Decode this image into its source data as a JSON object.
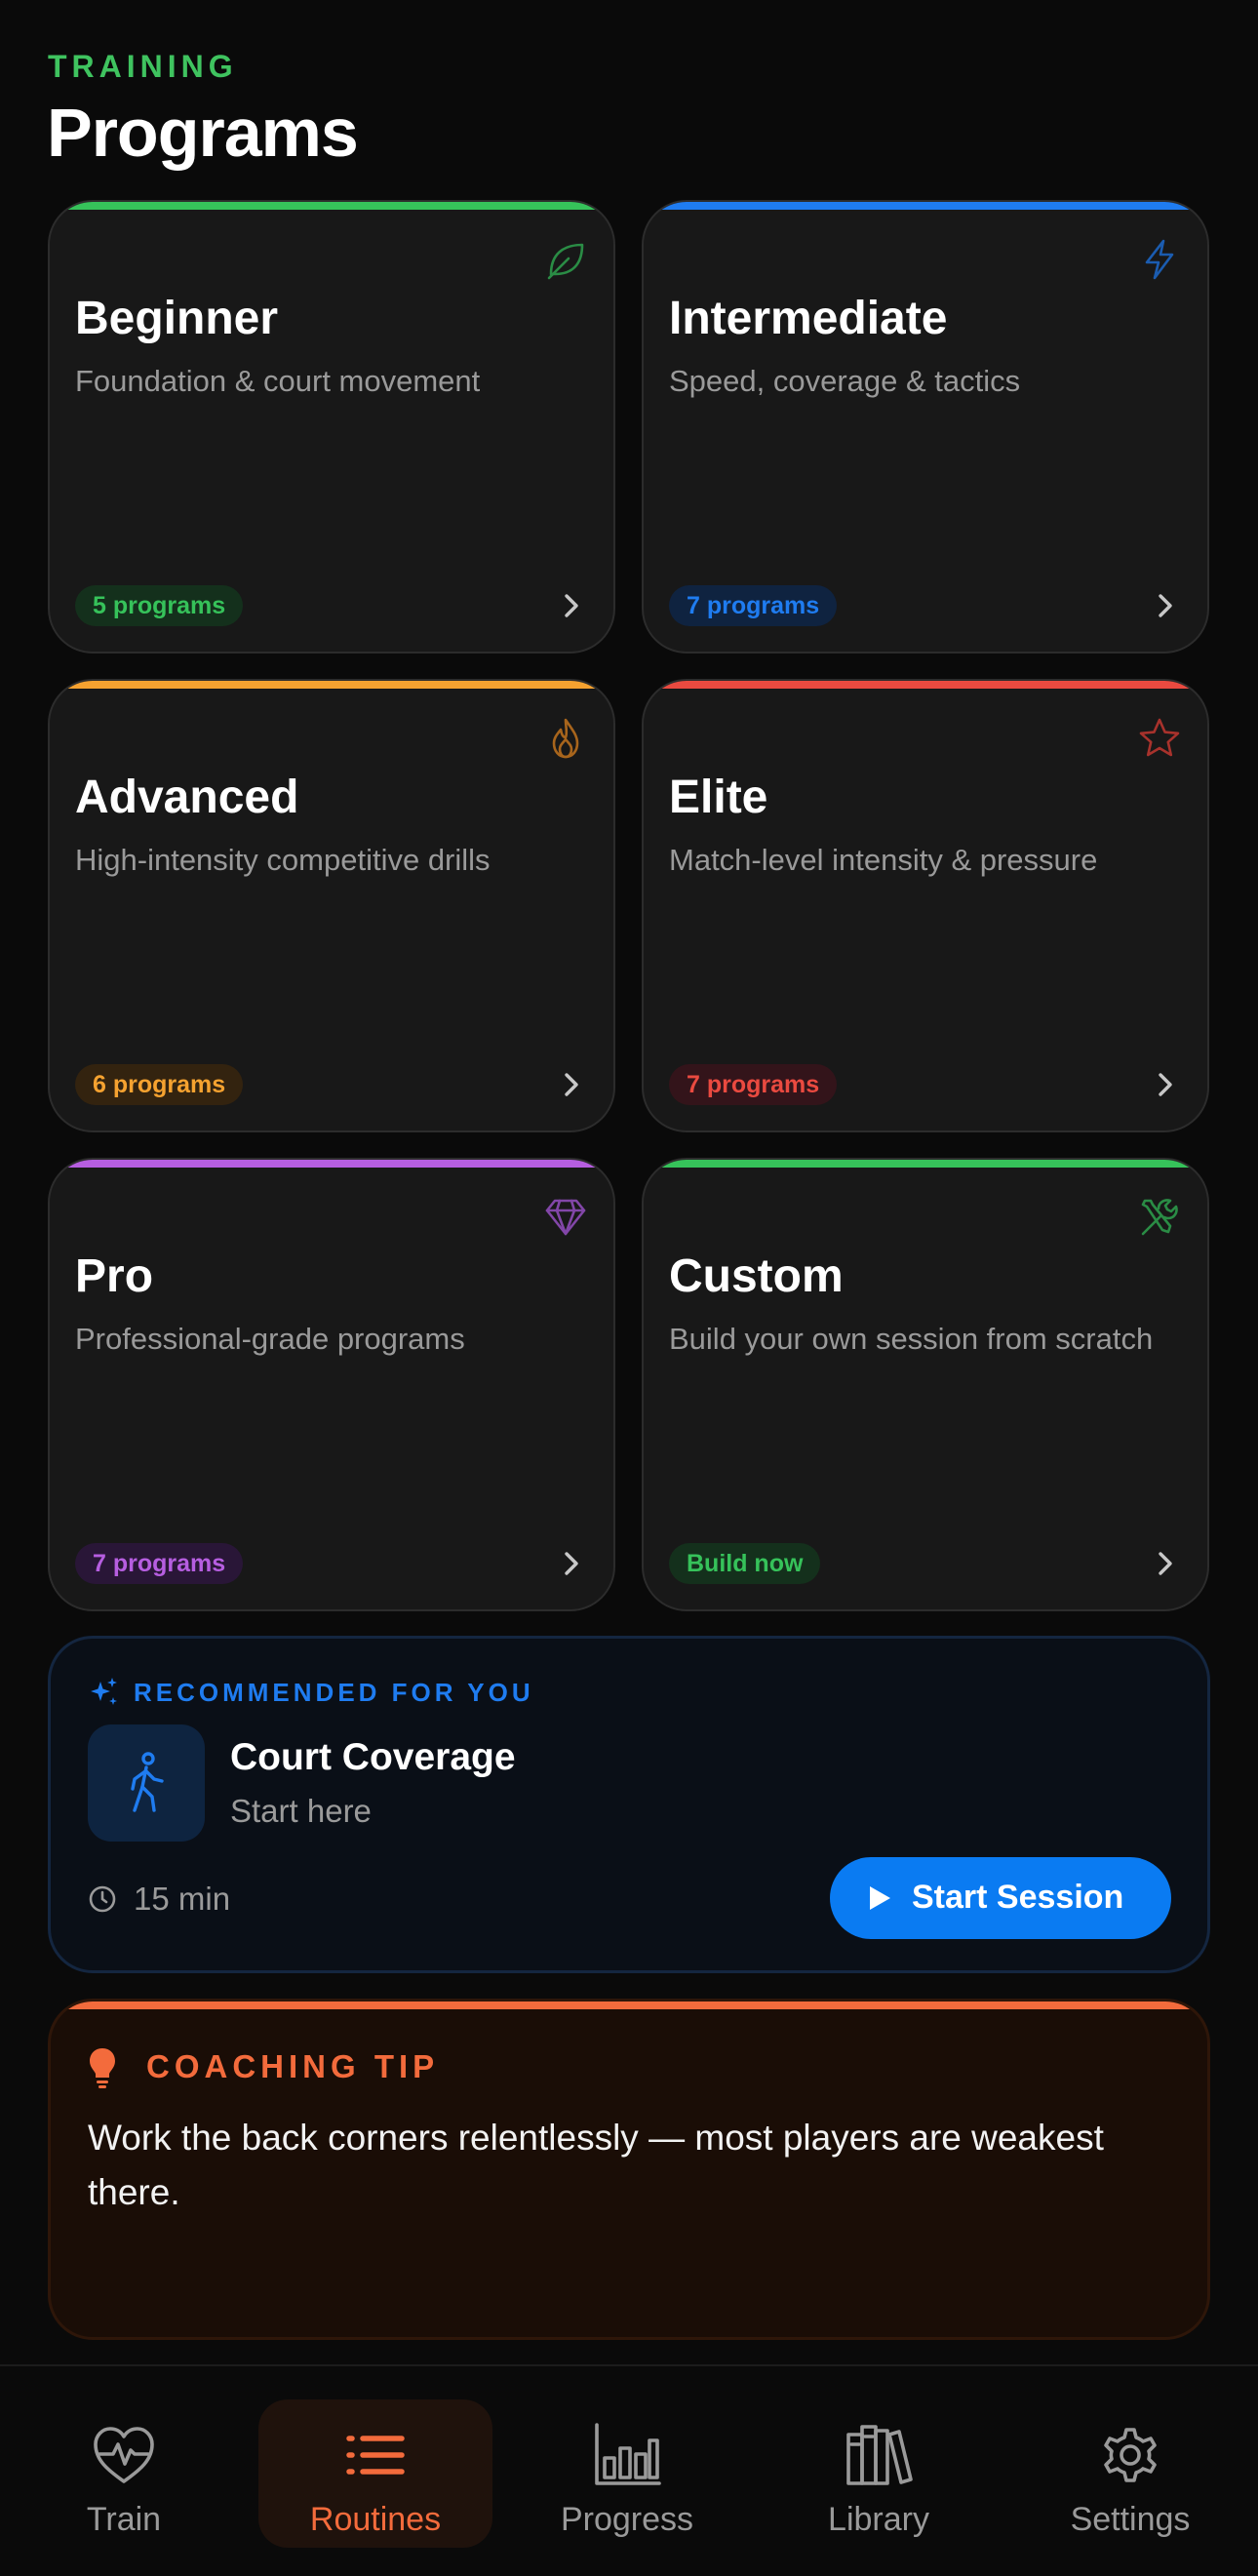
{
  "header": {
    "eyebrow": "TRAINING",
    "title": "Programs"
  },
  "cards": [
    {
      "title": "Beginner",
      "description": "Foundation & court movement",
      "badge": "5 programs",
      "accent": "#36c25a",
      "icon": "leaf-icon"
    },
    {
      "title": "Intermediate",
      "description": "Speed, coverage & tactics",
      "badge": "7 programs",
      "accent": "#1f7cf0",
      "icon": "lightning-icon"
    },
    {
      "title": "Advanced",
      "description": "High-intensity competitive drills",
      "badge": "6 programs",
      "accent": "#f5a230",
      "icon": "flame-icon"
    },
    {
      "title": "Elite",
      "description": "Match-level intensity & pressure",
      "badge": "7 programs",
      "accent": "#ea4a40",
      "icon": "star-icon"
    },
    {
      "title": "Pro",
      "description": "Professional-grade programs",
      "badge": "7 programs",
      "accent": "#b65ee0",
      "icon": "diamond-icon"
    },
    {
      "title": "Custom",
      "description": "Build your own session from scratch",
      "badge": "Build now",
      "accent": "#36c25a",
      "icon": "tools-icon"
    }
  ],
  "recommended": {
    "label": "RECOMMENDED FOR YOU",
    "title": "Court Coverage",
    "subtitle": "Start here",
    "duration": "15 min",
    "button_label": "Start Session",
    "accent": "#0a7bf2"
  },
  "tip": {
    "label": "COACHING TIP",
    "text": "Work the back corners relentlessly — most players are weakest there.",
    "accent": "#f36b3c"
  },
  "tabs": [
    {
      "label": "Train",
      "icon": "heart-pulse-icon",
      "active": false
    },
    {
      "label": "Routines",
      "icon": "list-icon",
      "active": true
    },
    {
      "label": "Progress",
      "icon": "bar-chart-icon",
      "active": false
    },
    {
      "label": "Library",
      "icon": "books-icon",
      "active": false
    },
    {
      "label": "Settings",
      "icon": "gear-icon",
      "active": false
    }
  ]
}
